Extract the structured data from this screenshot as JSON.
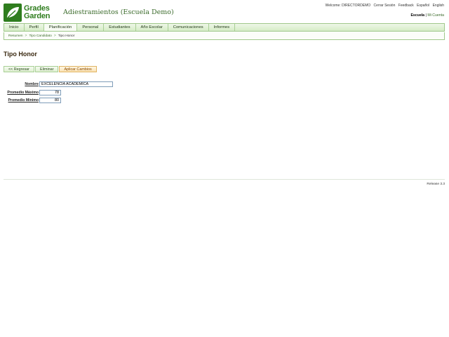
{
  "logo": {
    "line1": "Grades",
    "line2": "Garden"
  },
  "school_title": "Adiestramientos (Escuela Demo)",
  "top_links": {
    "welcome": "Welcome: DIRECTORDEMO",
    "logout": "Cerrar Sesión",
    "feedback": "Feedback",
    "spanish": "Español",
    "english": "English"
  },
  "account": {
    "school": "Escuela",
    "separator": "|",
    "my_account": "Mi Cuenta"
  },
  "nav": {
    "items": [
      {
        "label": "Inicio"
      },
      {
        "label": "Perfil"
      },
      {
        "label": "Planificación"
      },
      {
        "label": "Personal"
      },
      {
        "label": "Estudiantes"
      },
      {
        "label": "Año Escolar"
      },
      {
        "label": "Comunicaciones"
      },
      {
        "label": "Informes"
      }
    ]
  },
  "breadcrumb": {
    "items": [
      "Resumen",
      "Tipo Candidato",
      "Tipo Honor"
    ],
    "separator": ">"
  },
  "page_title": "Tipo Honor",
  "buttons": {
    "back": "<< Regresar",
    "delete": "Eliminar",
    "apply": "Aplicar Cambios"
  },
  "form": {
    "name_label": "Nombre",
    "name_value": "EXCELENCIA ACADEMICA",
    "max_label": "Promedio Máximo",
    "max_value": "78",
    "min_label": "Promedio Mínimo",
    "min_value": "80"
  },
  "release": "Release 3.3",
  "colors": {
    "brand_green": "#2f7d1e",
    "nav_bg": "#d5ecc6",
    "apply_orange": "#fbe3b4"
  }
}
